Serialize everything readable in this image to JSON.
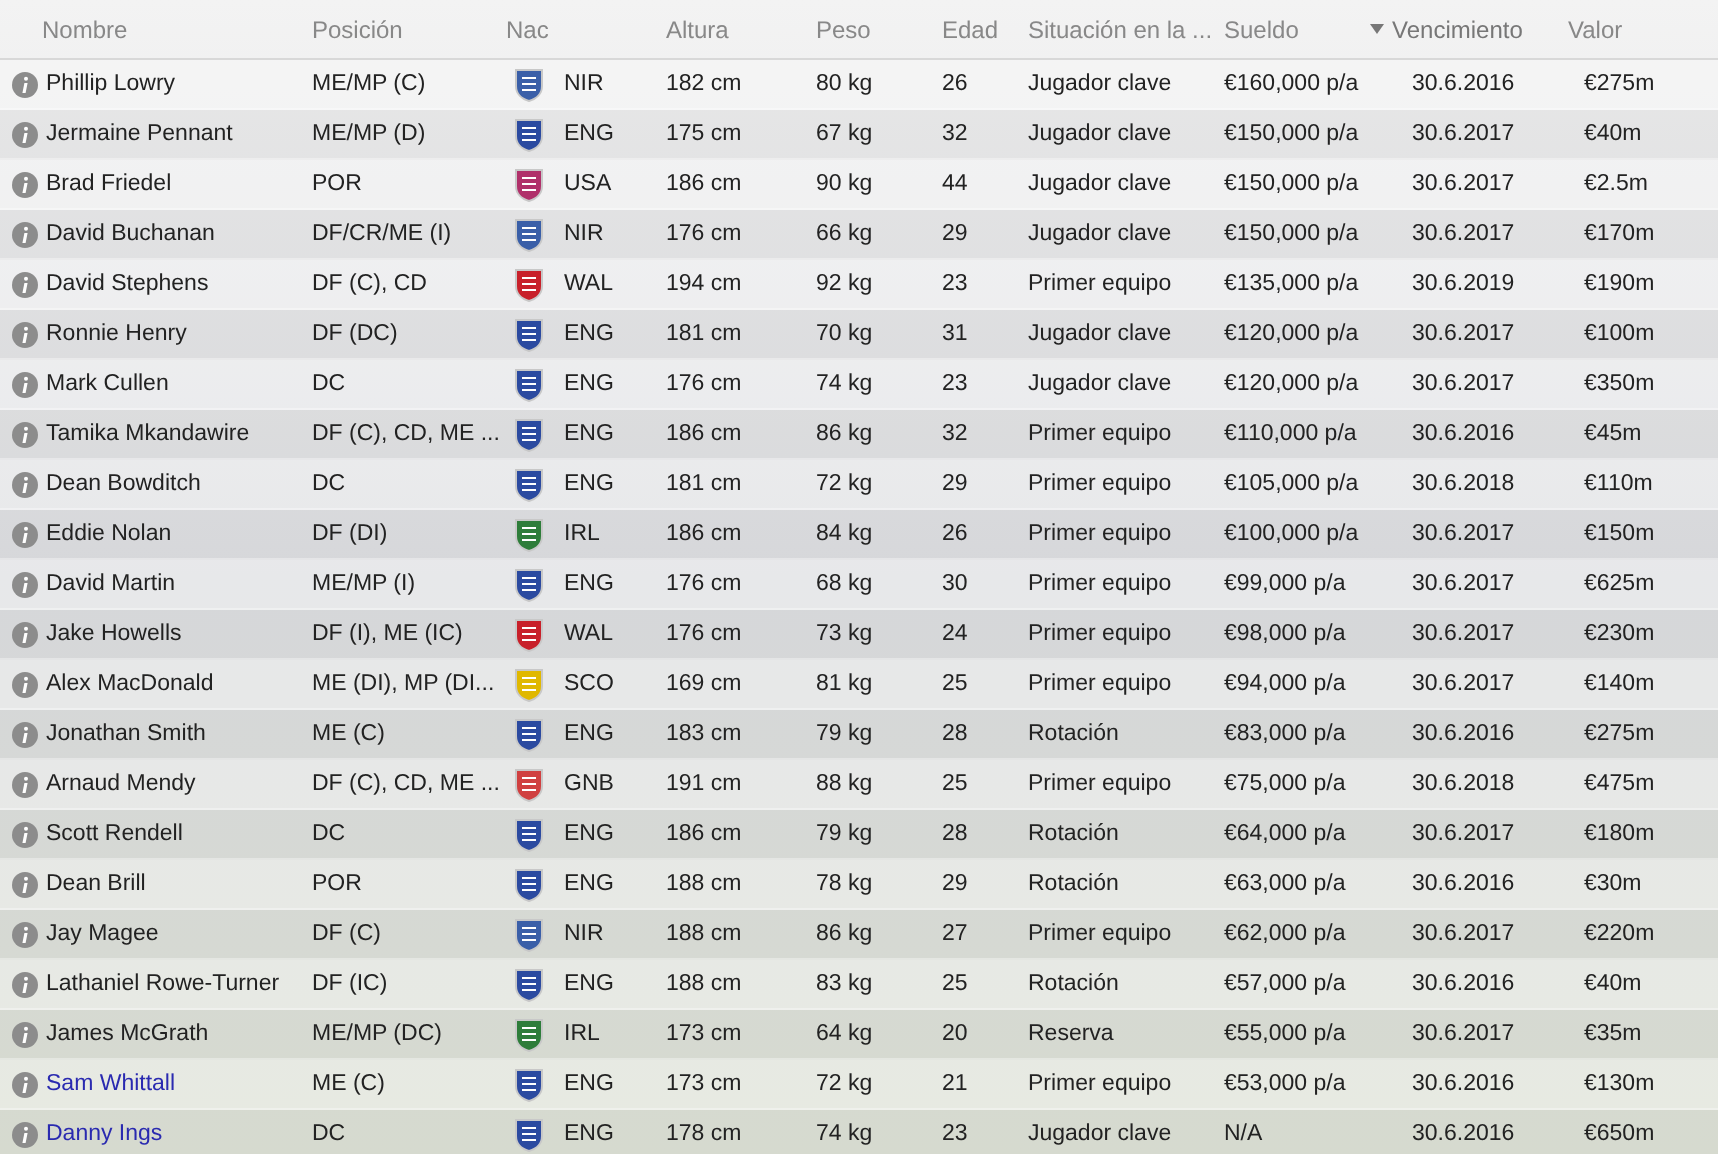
{
  "table": {
    "columns": [
      {
        "label": "Nombre",
        "sorted": false
      },
      {
        "label": "Posición",
        "sorted": false
      },
      {
        "label": "Nac",
        "sorted": false
      },
      {
        "label": "Altura",
        "sorted": false
      },
      {
        "label": "Peso",
        "sorted": false
      },
      {
        "label": "Edad",
        "sorted": false
      },
      {
        "label": "Situación en la ...",
        "sorted": false
      },
      {
        "label": "Sueldo",
        "sorted": false
      },
      {
        "label": "Vencimiento",
        "sorted": true
      },
      {
        "label": "Valor",
        "sorted": false
      }
    ],
    "rows": [
      {
        "name": "Phillip Lowry",
        "highlighted": false,
        "position": "ME/MP (C)",
        "color": "#3a5fa8",
        "nation": "NIR",
        "height": "182 cm",
        "weight": "80 kg",
        "age": "26",
        "status": "Jugador clave",
        "wage": "€160,000 p/a",
        "expires": "30.6.2016",
        "value": "€275m"
      },
      {
        "name": "Jermaine Pennant",
        "highlighted": false,
        "position": "ME/MP (D)",
        "color": "#2b4aa0",
        "nation": "ENG",
        "height": "175 cm",
        "weight": "67 kg",
        "age": "32",
        "status": "Jugador clave",
        "wage": "€150,000 p/a",
        "expires": "30.6.2017",
        "value": "€40m"
      },
      {
        "name": "Brad Friedel",
        "highlighted": false,
        "position": "POR",
        "color": "#b0306a",
        "nation": "USA",
        "height": "186 cm",
        "weight": "90 kg",
        "age": "44",
        "status": "Jugador clave",
        "wage": "€150,000 p/a",
        "expires": "30.6.2017",
        "value": "€2.5m"
      },
      {
        "name": "David Buchanan",
        "highlighted": false,
        "position": "DF/CR/ME (I)",
        "color": "#3a5fa8",
        "nation": "NIR",
        "height": "176 cm",
        "weight": "66 kg",
        "age": "29",
        "status": "Jugador clave",
        "wage": "€150,000 p/a",
        "expires": "30.6.2017",
        "value": "€170m"
      },
      {
        "name": "David Stephens",
        "highlighted": false,
        "position": "DF (C), CD",
        "color": "#c8202a",
        "nation": "WAL",
        "height": "194 cm",
        "weight": "92 kg",
        "age": "23",
        "status": "Primer equipo",
        "wage": "€135,000 p/a",
        "expires": "30.6.2019",
        "value": "€190m"
      },
      {
        "name": "Ronnie Henry",
        "highlighted": false,
        "position": "DF (DC)",
        "color": "#2b4aa0",
        "nation": "ENG",
        "height": "181 cm",
        "weight": "70 kg",
        "age": "31",
        "status": "Jugador clave",
        "wage": "€120,000 p/a",
        "expires": "30.6.2017",
        "value": "€100m"
      },
      {
        "name": "Mark Cullen",
        "highlighted": false,
        "position": "DC",
        "color": "#2b4aa0",
        "nation": "ENG",
        "height": "176 cm",
        "weight": "74 kg",
        "age": "23",
        "status": "Jugador clave",
        "wage": "€120,000 p/a",
        "expires": "30.6.2017",
        "value": "€350m"
      },
      {
        "name": "Tamika Mkandawire",
        "highlighted": false,
        "position": "DF (C), CD, ME ...",
        "color": "#2b4aa0",
        "nation": "ENG",
        "height": "186 cm",
        "weight": "86 kg",
        "age": "32",
        "status": "Primer equipo",
        "wage": "€110,000 p/a",
        "expires": "30.6.2016",
        "value": "€45m"
      },
      {
        "name": "Dean Bowditch",
        "highlighted": false,
        "position": "DC",
        "color": "#2b4aa0",
        "nation": "ENG",
        "height": "181 cm",
        "weight": "72 kg",
        "age": "29",
        "status": "Primer equipo",
        "wage": "€105,000 p/a",
        "expires": "30.6.2018",
        "value": "€110m"
      },
      {
        "name": "Eddie Nolan",
        "highlighted": false,
        "position": "DF (DI)",
        "color": "#2e7d3a",
        "nation": "IRL",
        "height": "186 cm",
        "weight": "84 kg",
        "age": "26",
        "status": "Primer equipo",
        "wage": "€100,000 p/a",
        "expires": "30.6.2017",
        "value": "€150m"
      },
      {
        "name": "David Martin",
        "highlighted": false,
        "position": "ME/MP (I)",
        "color": "#2b4aa0",
        "nation": "ENG",
        "height": "176 cm",
        "weight": "68 kg",
        "age": "30",
        "status": "Primer equipo",
        "wage": "€99,000 p/a",
        "expires": "30.6.2017",
        "value": "€625m"
      },
      {
        "name": "Jake Howells",
        "highlighted": false,
        "position": "DF (I), ME (IC)",
        "color": "#c8202a",
        "nation": "WAL",
        "height": "176 cm",
        "weight": "73 kg",
        "age": "24",
        "status": "Primer equipo",
        "wage": "€98,000 p/a",
        "expires": "30.6.2017",
        "value": "€230m"
      },
      {
        "name": "Alex MacDonald",
        "highlighted": false,
        "position": "ME (DI), MP (DI...",
        "color": "#e0b800",
        "nation": "SCO",
        "height": "169 cm",
        "weight": "81 kg",
        "age": "25",
        "status": "Primer equipo",
        "wage": "€94,000 p/a",
        "expires": "30.6.2017",
        "value": "€140m"
      },
      {
        "name": "Jonathan Smith",
        "highlighted": false,
        "position": "ME (C)",
        "color": "#2b4aa0",
        "nation": "ENG",
        "height": "183 cm",
        "weight": "79 kg",
        "age": "28",
        "status": "Rotación",
        "wage": "€83,000 p/a",
        "expires": "30.6.2016",
        "value": "€275m"
      },
      {
        "name": "Arnaud Mendy",
        "highlighted": false,
        "position": "DF (C), CD, ME ...",
        "color": "#d04040",
        "nation": "GNB",
        "height": "191 cm",
        "weight": "88 kg",
        "age": "25",
        "status": "Primer equipo",
        "wage": "€75,000 p/a",
        "expires": "30.6.2018",
        "value": "€475m"
      },
      {
        "name": "Scott Rendell",
        "highlighted": false,
        "position": "DC",
        "color": "#2b4aa0",
        "nation": "ENG",
        "height": "186 cm",
        "weight": "79 kg",
        "age": "28",
        "status": "Rotación",
        "wage": "€64,000 p/a",
        "expires": "30.6.2017",
        "value": "€180m"
      },
      {
        "name": "Dean Brill",
        "highlighted": false,
        "position": "POR",
        "color": "#2b4aa0",
        "nation": "ENG",
        "height": "188 cm",
        "weight": "78 kg",
        "age": "29",
        "status": "Rotación",
        "wage": "€63,000 p/a",
        "expires": "30.6.2016",
        "value": "€30m"
      },
      {
        "name": "Jay Magee",
        "highlighted": false,
        "position": "DF (C)",
        "color": "#3a5fa8",
        "nation": "NIR",
        "height": "188 cm",
        "weight": "86 kg",
        "age": "27",
        "status": "Primer equipo",
        "wage": "€62,000 p/a",
        "expires": "30.6.2017",
        "value": "€220m"
      },
      {
        "name": "Lathaniel Rowe-Turner",
        "highlighted": false,
        "position": "DF (IC)",
        "color": "#2b4aa0",
        "nation": "ENG",
        "height": "188 cm",
        "weight": "83 kg",
        "age": "25",
        "status": "Rotación",
        "wage": "€57,000 p/a",
        "expires": "30.6.2016",
        "value": "€40m"
      },
      {
        "name": "James McGrath",
        "highlighted": false,
        "position": "ME/MP (DC)",
        "color": "#2e7d3a",
        "nation": "IRL",
        "height": "173 cm",
        "weight": "64 kg",
        "age": "20",
        "status": "Reserva",
        "wage": "€55,000 p/a",
        "expires": "30.6.2017",
        "value": "€35m"
      },
      {
        "name": "Sam Whittall",
        "highlighted": true,
        "position": "ME (C)",
        "color": "#2b4aa0",
        "nation": "ENG",
        "height": "173 cm",
        "weight": "72 kg",
        "age": "21",
        "status": "Primer equipo",
        "wage": "€53,000 p/a",
        "expires": "30.6.2016",
        "value": "€130m"
      },
      {
        "name": "Danny Ings",
        "highlighted": true,
        "position": "DC",
        "color": "#2b4aa0",
        "nation": "ENG",
        "height": "178 cm",
        "weight": "74 kg",
        "age": "23",
        "status": "Jugador clave",
        "wage": "N/A",
        "expires": "30.6.2016",
        "value": "€650m"
      }
    ]
  }
}
